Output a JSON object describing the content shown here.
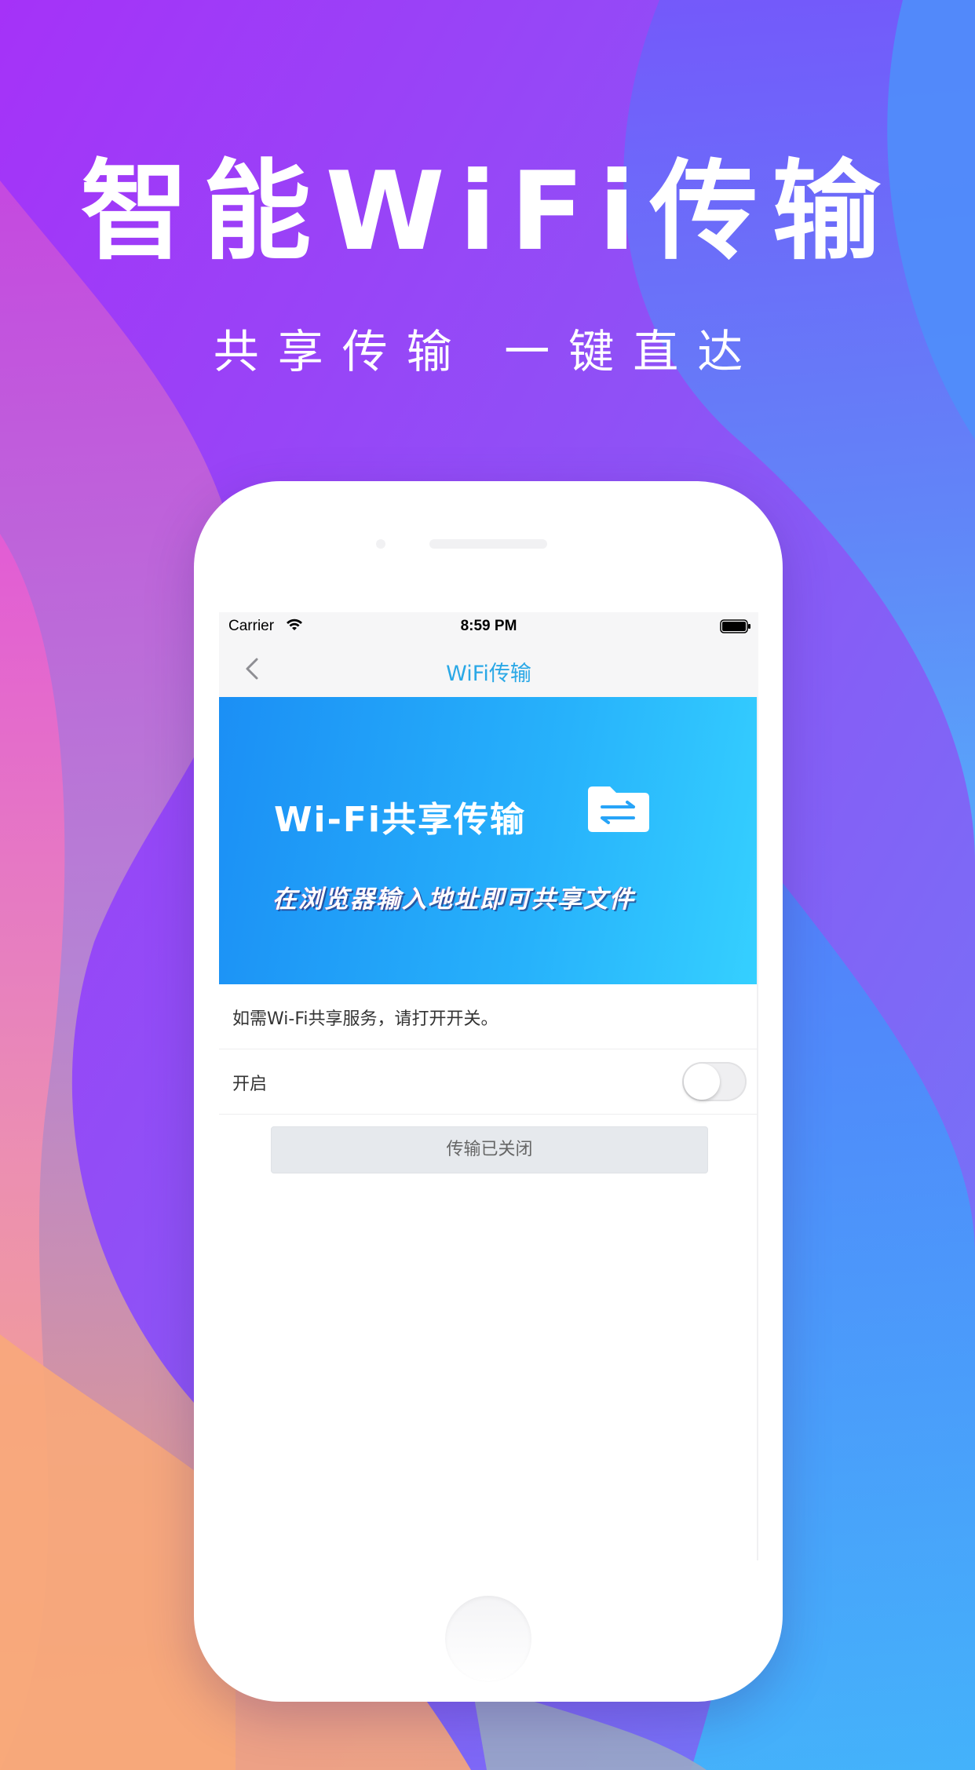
{
  "promo": {
    "headline": "智能WiFi传输",
    "subline": "共享传输 一键直达"
  },
  "status_bar": {
    "carrier": "Carrier",
    "time": "8:59 PM"
  },
  "nav": {
    "title": "WiFi传输"
  },
  "banner": {
    "title": "Wi-Fi共享传输",
    "subtitle": "在浏览器输入地址即可共享文件"
  },
  "settings": {
    "hint": "如需Wi-Fi共享服务，请打开开关。",
    "toggle_label": "开启",
    "toggle_on": false,
    "status_button": "传输已关闭"
  },
  "colors": {
    "accent": "#2aa8e6",
    "banner_start": "#1b8ff5",
    "banner_end": "#35d0ff",
    "button_bg": "#e6e9ed"
  }
}
